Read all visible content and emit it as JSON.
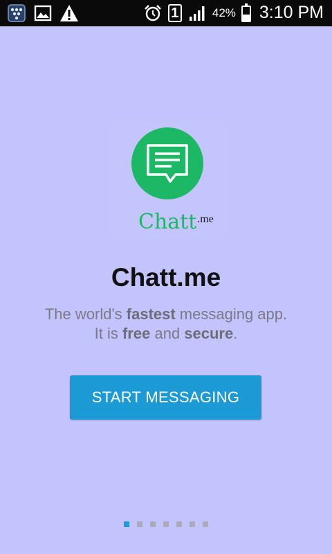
{
  "status_bar": {
    "battery_percent": "42%",
    "battery_level": 0.42,
    "time": "3:10 PM",
    "sim_slot": "1",
    "icons": [
      "bbm-icon",
      "image-icon",
      "warning-icon",
      "alarm-icon",
      "sim-icon",
      "signal-icon",
      "battery-icon"
    ]
  },
  "logo": {
    "word": "Chatt",
    "suffix": ".me",
    "brand_color": "#1cb866"
  },
  "main": {
    "title": "Chatt.me",
    "tagline_line1_prefix": "The world's ",
    "tagline_line1_bold": "fastest",
    "tagline_line1_suffix": " messaging app.",
    "tagline_line2_prefix": "It is ",
    "tagline_line2_bold1": "free",
    "tagline_line2_mid": " and ",
    "tagline_line2_bold2": "secure",
    "tagline_line2_suffix": "."
  },
  "cta": {
    "start_label": "START MESSAGING",
    "color": "#1c9ad6"
  },
  "pager": {
    "count": 7,
    "active_index": 0
  },
  "colors": {
    "background": "#c3c4fe",
    "status_bar": "#0a0a0a"
  }
}
